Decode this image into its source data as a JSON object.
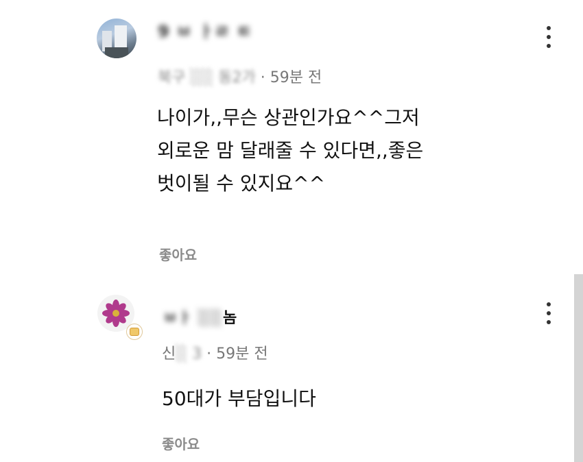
{
  "comments": [
    {
      "author": "9 ㅂ ㅏㄹ ㅌ",
      "location": "북구 ░░ 동2가",
      "time": "59분 전",
      "text_lines": [
        "나이가,,무슨 상관인가요^^그저",
        "외로운 맘 달래줄 수 있다면,,좋은",
        "벗이될 수 있지요^^"
      ],
      "like_label": "좋아요"
    },
    {
      "author_prefix": "ㅂㅏ ░░",
      "author_suffix": "놈",
      "location_prefix": "신",
      "location_blur": "░ 3",
      "time": "59분 전",
      "text_lines": [
        "50대가 부담입니다"
      ],
      "like_label": "좋아요"
    }
  ],
  "separator": "·",
  "icons": {
    "more": "more-vertical-icon",
    "badge": "level-badge-icon"
  }
}
